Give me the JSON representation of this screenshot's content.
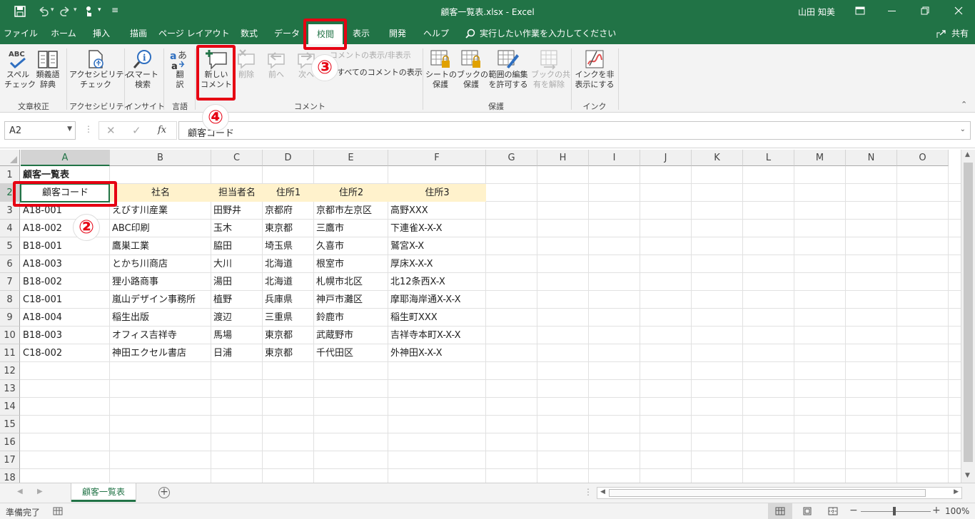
{
  "window": {
    "title": "顧客一覧表.xlsx  -  Excel",
    "user": "山田 知美"
  },
  "tabs": [
    "ファイル",
    "ホーム",
    "挿入",
    "描画",
    "ページ レイアウト",
    "数式",
    "データ",
    "校閲",
    "表示",
    "開発",
    "ヘルプ"
  ],
  "selected_tab": "校閲",
  "tell_me": "実行したい作業を入力してください",
  "share": "共有",
  "ribbon": {
    "spelling": [
      "スペル",
      "チェック"
    ],
    "thesaurus": [
      "類義語",
      "辞典"
    ],
    "group_proofing": "文章校正",
    "access_check": [
      "アクセシビリティ",
      "チェック"
    ],
    "group_access": "アクセシビリティ",
    "smart_lookup": [
      "スマート",
      "検索"
    ],
    "group_insights": "インサイト",
    "translate": [
      "翻",
      "訳"
    ],
    "group_language": "言語",
    "new_comment": [
      "新しい",
      "コメント"
    ],
    "delete": "削除",
    "prev": "前へ",
    "next": "次へ",
    "show_hide": "コメントの表示/非表示",
    "show_all": "すべてのコメントの表示",
    "group_comments": "コメント",
    "protect_sheet": [
      "シートの",
      "保護"
    ],
    "protect_book": [
      "ブックの",
      "保護"
    ],
    "allow_edit": [
      "範囲の編集",
      "を許可する"
    ],
    "unshare": [
      "ブックの共",
      "有を解除"
    ],
    "group_protect": "保護",
    "hide_ink": [
      "インクを非",
      "表示にする"
    ],
    "group_ink": "インク"
  },
  "formula_bar": {
    "name_box": "A2",
    "formula": "顧客コード",
    "fx": "fx"
  },
  "columns": [
    "A",
    "B",
    "C",
    "D",
    "E",
    "F",
    "G",
    "H",
    "I",
    "J",
    "K",
    "L",
    "M",
    "N",
    "O"
  ],
  "rows": [
    "1",
    "2",
    "3",
    "4",
    "5",
    "6",
    "7",
    "8",
    "9",
    "10",
    "11",
    "12",
    "13",
    "14",
    "15",
    "16",
    "17",
    "18"
  ],
  "sheet": {
    "title": "顧客一覧表",
    "headers": [
      "顧客コード",
      "社名",
      "担当者名",
      "住所1",
      "住所2",
      "住所3"
    ],
    "data": [
      [
        "A18-001",
        "えびす川産業",
        "田野井",
        "京都府",
        "京都市左京区",
        "高野XXX"
      ],
      [
        "A18-002",
        "ABC印刷",
        "玉木",
        "東京都",
        "三鷹市",
        "下連雀X-X-X"
      ],
      [
        "B18-001",
        "鷹巣工業",
        "脇田",
        "埼玉県",
        "久喜市",
        "鷲宮X-X"
      ],
      [
        "A18-003",
        "とかち川商店",
        "大川",
        "北海道",
        "根室市",
        "厚床X-X-X"
      ],
      [
        "B18-002",
        "狸小路商事",
        "湯田",
        "北海道",
        "札幌市北区",
        "北12条西X-X"
      ],
      [
        "C18-001",
        "嵐山デザイン事務所",
        "植野",
        "兵庫県",
        "神戸市灘区",
        "摩耶海岸通X-X-X"
      ],
      [
        "A18-004",
        "稲生出版",
        "渡辺",
        "三重県",
        "鈴鹿市",
        "稲生町XXX"
      ],
      [
        "B18-003",
        "オフィス吉祥寺",
        "馬場",
        "東京都",
        "武蔵野市",
        "吉祥寺本町X-X-X"
      ],
      [
        "C18-002",
        "神田エクセル書店",
        "日浦",
        "東京都",
        "千代田区",
        "外神田X-X-X"
      ]
    ]
  },
  "sheet_tab": "顧客一覧表",
  "status": {
    "ready": "準備完了",
    "zoom": "100%"
  },
  "callouts": [
    "②",
    "③",
    "④"
  ],
  "colors": {
    "excel_green": "#217346",
    "highlight": "#e60012",
    "header_fill": "#fff2cc"
  }
}
